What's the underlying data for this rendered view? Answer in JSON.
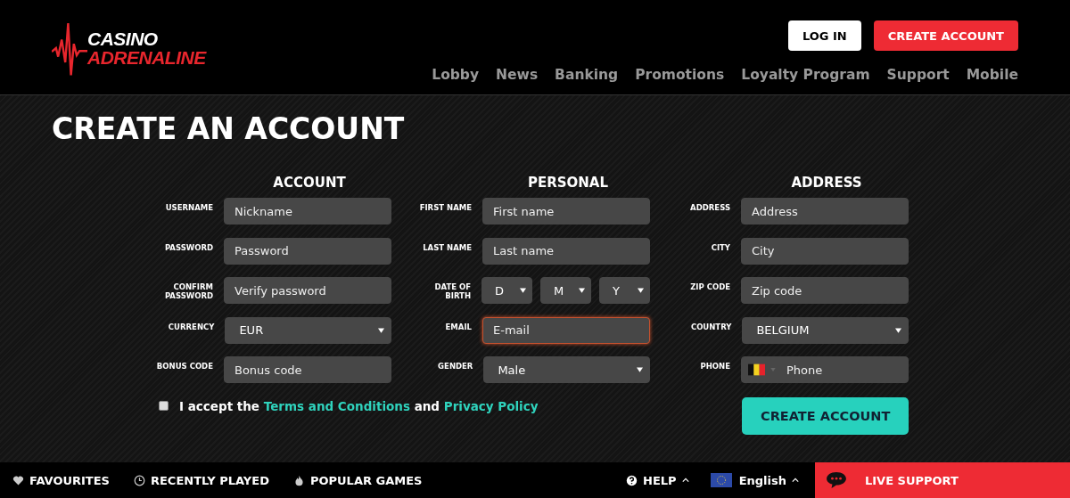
{
  "header": {
    "logo": {
      "line1": "CASINO",
      "line2": "ADRENALINE"
    },
    "buttons": [
      {
        "label": "LOG IN",
        "kind": "outline"
      },
      {
        "label": "CREATE ACCOUNT",
        "kind": "primary"
      }
    ],
    "nav": [
      {
        "label": "Lobby"
      },
      {
        "label": "News"
      },
      {
        "label": "Banking"
      },
      {
        "label": "Promotions"
      },
      {
        "label": "Loyalty Program"
      },
      {
        "label": "Support"
      },
      {
        "label": "Mobile"
      }
    ]
  },
  "page_title": "CREATE AN ACCOUNT",
  "columns": [
    {
      "heading": "ACCOUNT",
      "fields": [
        {
          "label": "USERNAME",
          "kind": "text",
          "placeholder": "Nickname",
          "focused": false
        },
        {
          "label": "PASSWORD",
          "kind": "text",
          "placeholder": "Password",
          "focused": false
        },
        {
          "label": "CONFIRM PASSWORD",
          "kind": "text",
          "placeholder": "Verify password",
          "focused": false
        },
        {
          "label": "CURRENCY",
          "kind": "select",
          "value": "EUR"
        },
        {
          "label": "BONUS CODE",
          "kind": "text",
          "placeholder": "Bonus code",
          "focused": false
        }
      ]
    },
    {
      "heading": "PERSONAL",
      "fields": [
        {
          "label": "FIRST NAME",
          "kind": "text",
          "placeholder": "First name",
          "focused": false
        },
        {
          "label": "LAST NAME",
          "kind": "text",
          "placeholder": "Last name",
          "focused": false
        },
        {
          "label": "DATE OF BIRTH",
          "kind": "date",
          "parts": [
            "D",
            "M",
            "Y"
          ]
        },
        {
          "label": "EMAIL",
          "kind": "text",
          "placeholder": "E-mail",
          "focused": true
        },
        {
          "label": "GENDER",
          "kind": "select",
          "value": "Male"
        }
      ]
    },
    {
      "heading": "ADDRESS",
      "fields": [
        {
          "label": "ADDRESS",
          "kind": "text",
          "placeholder": "Address",
          "focused": false
        },
        {
          "label": "CITY",
          "kind": "text",
          "placeholder": "City",
          "focused": false
        },
        {
          "label": "ZIP CODE",
          "kind": "text",
          "placeholder": "Zip code",
          "focused": false
        },
        {
          "label": "COUNTRY",
          "kind": "select",
          "value": "BELGIUM"
        },
        {
          "label": "PHONE",
          "kind": "phone",
          "placeholder": "Phone"
        }
      ]
    }
  ],
  "terms": {
    "checked": false,
    "prefix": "I accept the",
    "link_1": "Terms and Conditions",
    "middle": "and",
    "link_2": "Privacy Policy"
  },
  "submit": "CREATE ACCOUNT",
  "footer": {
    "left": [
      {
        "label": "FAVOURITES"
      },
      {
        "label": "RECENTLY PLAYED"
      },
      {
        "label": "POPULAR GAMES"
      }
    ],
    "help": "HELP",
    "language": "English",
    "live_support": "LIVE SUPPORT"
  }
}
